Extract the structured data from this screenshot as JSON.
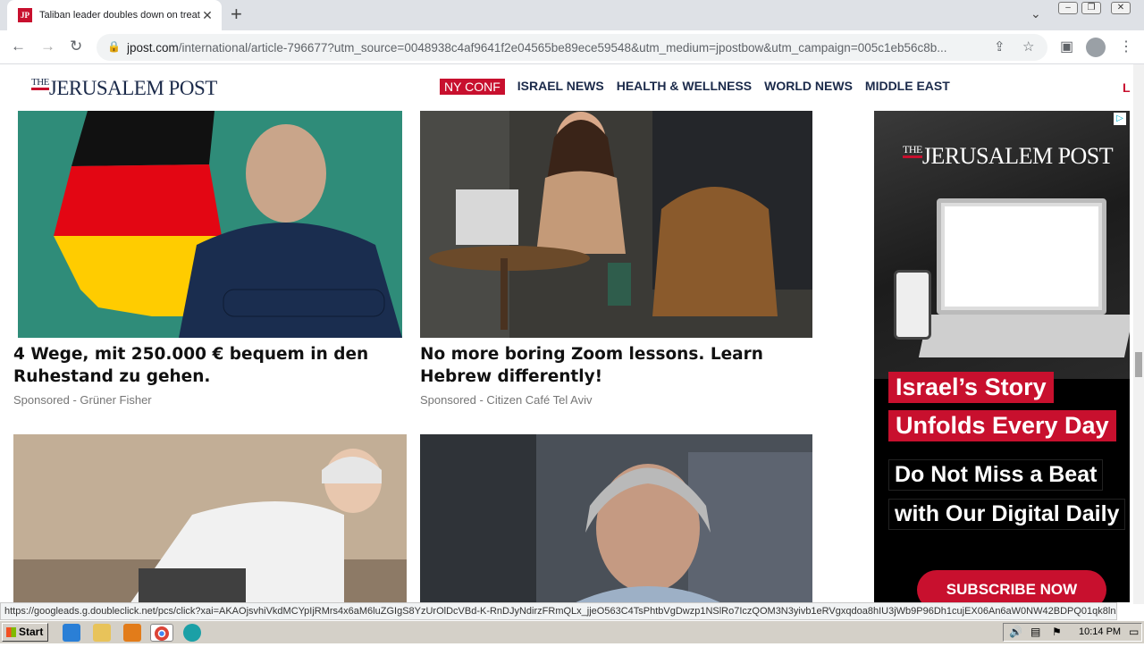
{
  "browser": {
    "tab_title": "Taliban leader doubles down on treat",
    "tab_favicon_text": "JP",
    "new_tab": "+",
    "url_domain": "jpost.com",
    "url_rest": "/international/article-796677?utm_source=0048938c4af9641f2e04565be89ece59548&utm_medium=jpostbow&utm_campaign=005c1eb56c8b...",
    "status_url": "https://googleads.g.doubleclick.net/pcs/click?xai=AKAOjsvhiVkdMCYpIjRMrs4x6aM6luZGIgS8YzUrOlDcVBd-K-RnDJyNdirzFRmQLx_jjeO563C4TsPhtbVgDwzp1NSlRo7IczQOM3N3yivb1eRVgxqdoa8hIU3jWb9P96Dh1cujEX06An6aW0NW42BDPQ01qk8lnX7MVcd7..."
  },
  "site": {
    "logo_the": "THE",
    "logo_main": "JERUSALEM POST",
    "nav": [
      "NY CONF",
      "ISRAEL NEWS",
      "HEALTH & WELLNESS",
      "WORLD NEWS",
      "MIDDLE EAST"
    ],
    "nav_more": "L"
  },
  "cards": [
    {
      "headline": "4 Wege, mit 250.000 € bequem in den Ruhestand zu gehen.",
      "sponsor": "Sponsored - Grüner Fisher"
    },
    {
      "headline": "No more boring Zoom lessons. Learn Hebrew differently!",
      "sponsor": "Sponsored - Citizen Café Tel Aviv"
    }
  ],
  "ad": {
    "logo_the": "THE",
    "logo_main": "JERUSALEM POST",
    "line1": "Israel’s Story",
    "line2": "Unfolds Every Day",
    "line3": "Do Not Miss a Beat",
    "line4": "with Our Digital Daily",
    "cta": "SUBSCRIBE NOW",
    "choice": "▷"
  },
  "taskbar": {
    "start": "Start",
    "clock": "10:14 PM"
  },
  "colors": {
    "brand_red": "#c8102e",
    "brand_navy": "#1b2a4a"
  }
}
